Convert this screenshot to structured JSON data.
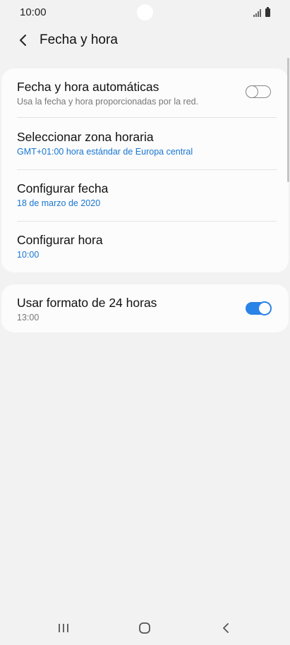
{
  "status_bar": {
    "time": "10:00",
    "icons": [
      "signal-icon",
      "battery-icon"
    ]
  },
  "header": {
    "back_icon": "back-arrow-icon",
    "title": "Fecha y hora"
  },
  "settings": {
    "auto_datetime": {
      "title": "Fecha y hora automáticas",
      "subtitle": "Usa la fecha y hora proporcionadas por la red.",
      "toggle_on": false
    },
    "time_zone": {
      "title": "Seleccionar zona horaria",
      "value": "GMT+01:00 hora estándar de Europa central"
    },
    "set_date": {
      "title": "Configurar fecha",
      "value": "18 de marzo de 2020"
    },
    "set_time": {
      "title": "Configurar hora",
      "value": "10:00"
    },
    "format_24h": {
      "title": "Usar formato de 24 horas",
      "value": "13:00",
      "toggle_on": true
    }
  },
  "nav_bar": {
    "icons": [
      "recent-apps-icon",
      "home-icon",
      "back-icon"
    ]
  },
  "colors": {
    "accent": "#2a83e6",
    "value_blue": "#1976d2",
    "background": "#f2f2f2",
    "card": "#fcfcfc"
  }
}
